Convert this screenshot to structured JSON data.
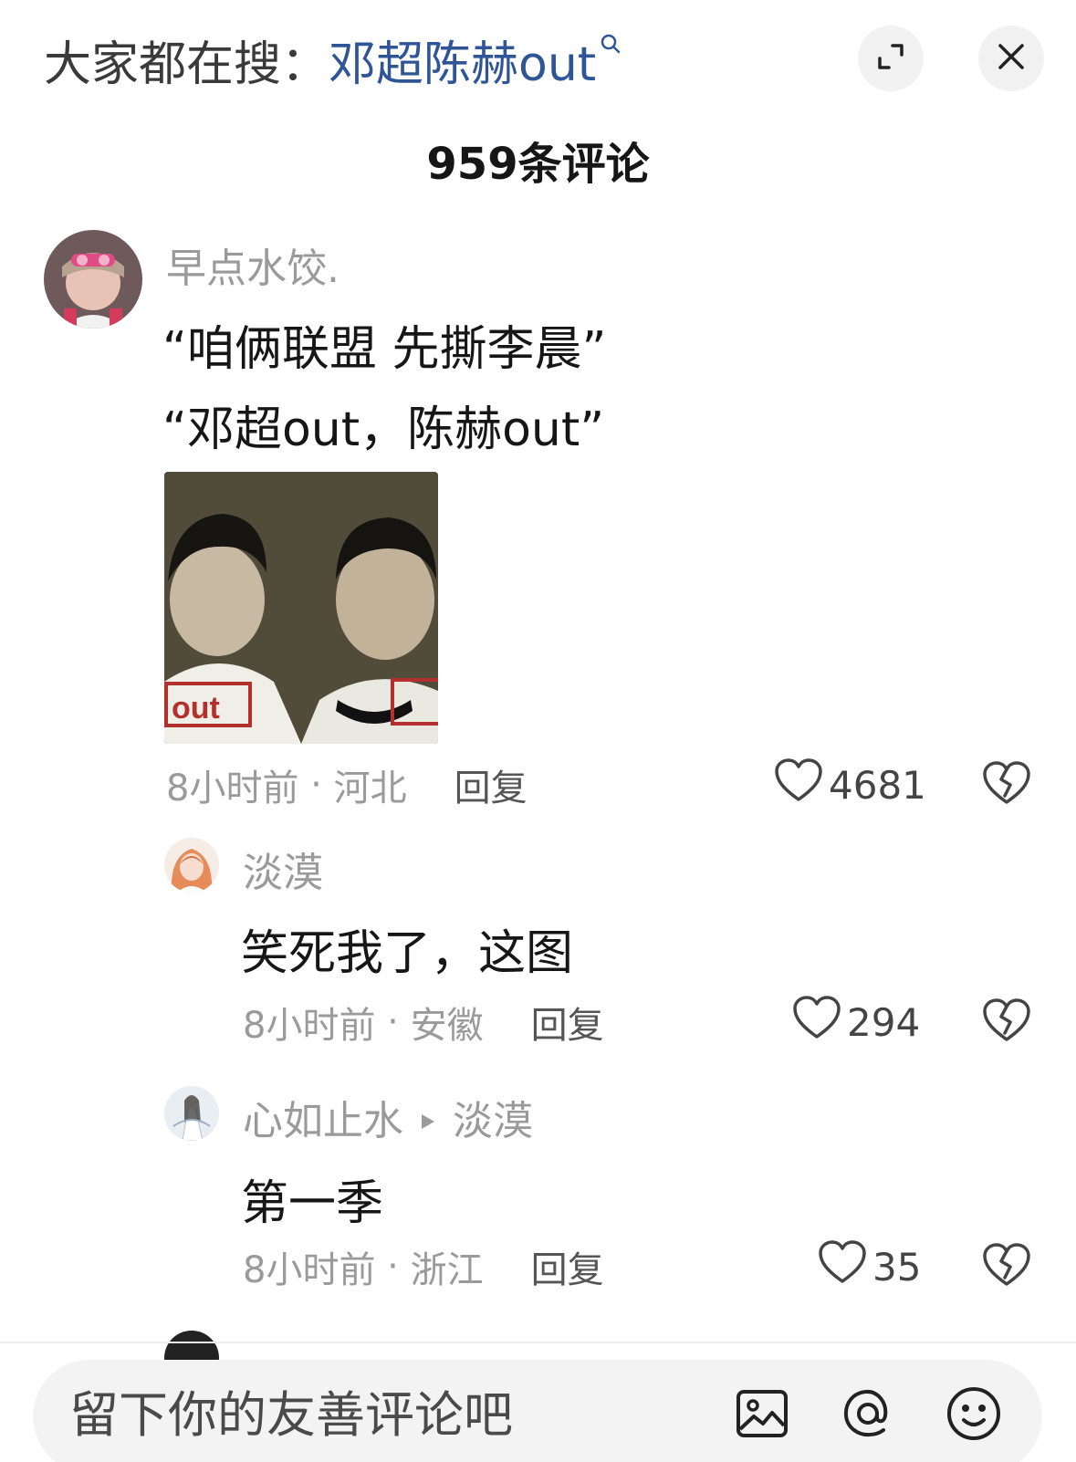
{
  "header": {
    "search_prefix": "大家都在搜：",
    "search_term": "邓超陈赫out",
    "search_q": "Q"
  },
  "comment_count": "959条评论",
  "comments": [
    {
      "user": "早点水饺.",
      "lines": [
        "“咱俩联盟 先撕李晨”",
        "“邓超out，陈赫out”"
      ],
      "time": "8小时前",
      "location": "河北",
      "reply": "回复",
      "likes": "4681"
    },
    {
      "user": "淡漠",
      "lines": [
        "笑死我了，这图"
      ],
      "time": "8小时前",
      "location": "安徽",
      "reply": "回复",
      "likes": "294"
    },
    {
      "user": "心如止水",
      "reply_to": "淡漠",
      "lines": [
        "第一季"
      ],
      "time": "8小时前",
      "location": "浙江",
      "reply": "回复",
      "likes": "35"
    }
  ],
  "photo_stamp": "out",
  "composer": {
    "placeholder": "留下你的友善评论吧"
  },
  "icons": {
    "expand": "expand-icon",
    "close": "close-icon",
    "heart": "heart-icon",
    "broken_heart": "broken-heart-icon",
    "image": "image-icon",
    "at": "at-icon",
    "emoji": "emoji-icon"
  }
}
